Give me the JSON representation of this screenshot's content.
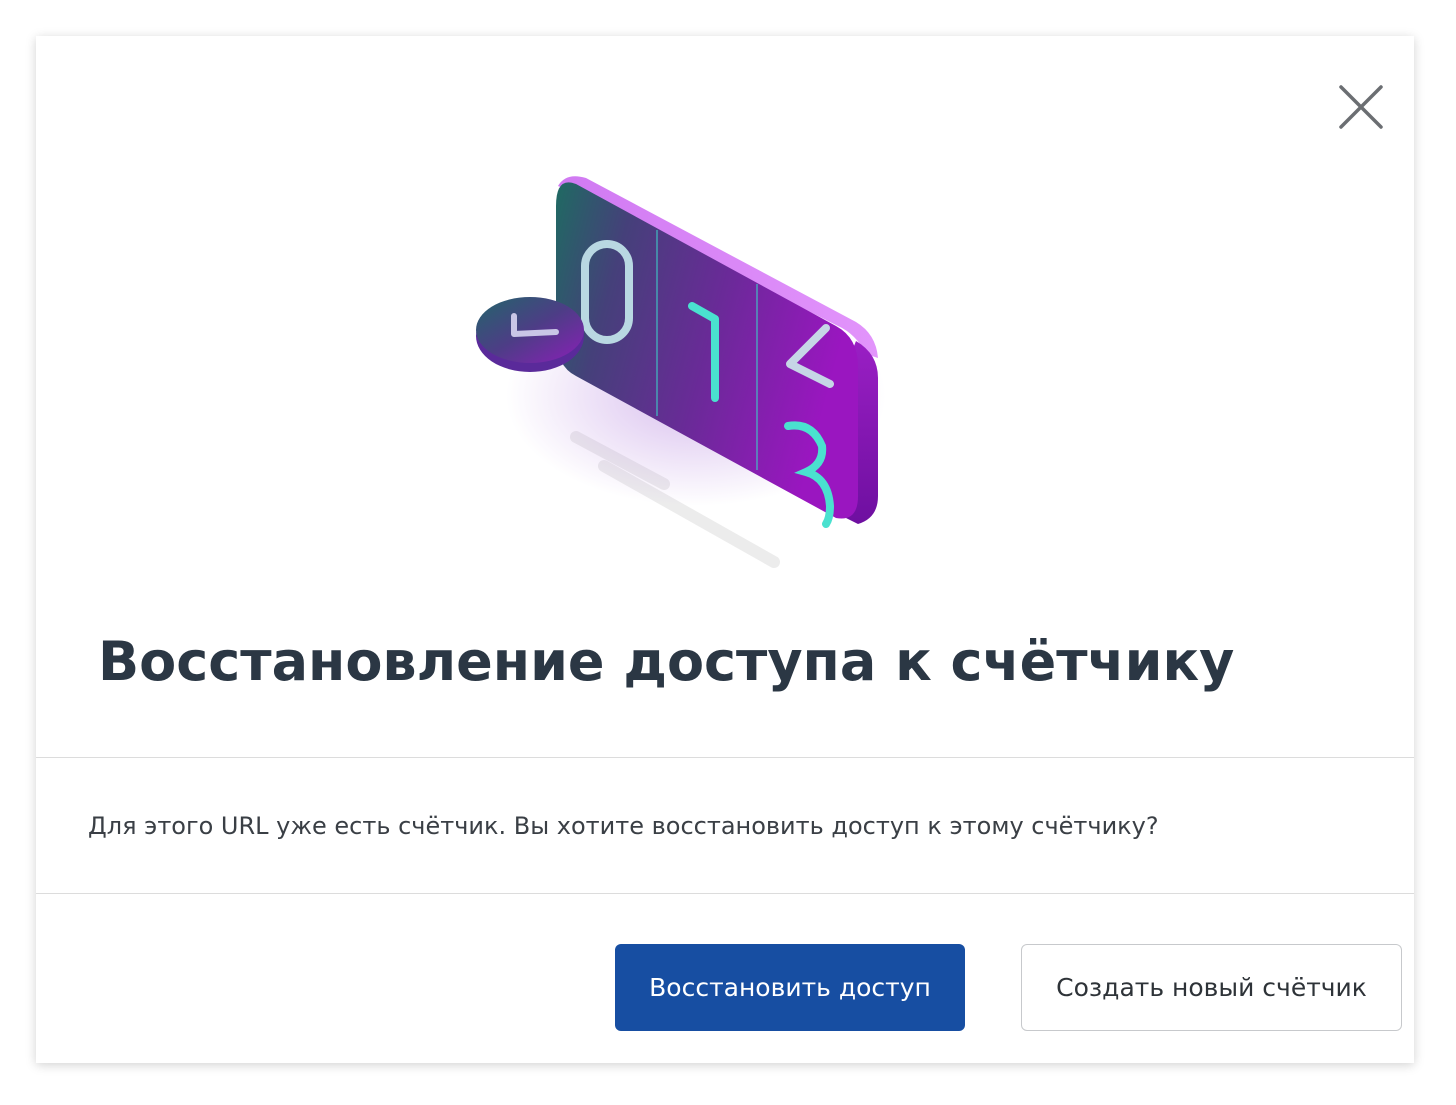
{
  "dialog": {
    "title": "Восстановление доступа к счётчику",
    "message": "Для этого URL уже есть счётчик. Вы хотите восстановить доступ к этому счётчику?",
    "close_icon": "close-icon",
    "illustration_icon": "counter-illustration",
    "buttons": {
      "restore_label": "Восстановить доступ",
      "create_label": "Создать новый счётчик"
    },
    "colors": {
      "primary": "#174ea2",
      "title": "#2b3744",
      "text": "#3a3f45",
      "divider": "#dcdcdc"
    }
  }
}
